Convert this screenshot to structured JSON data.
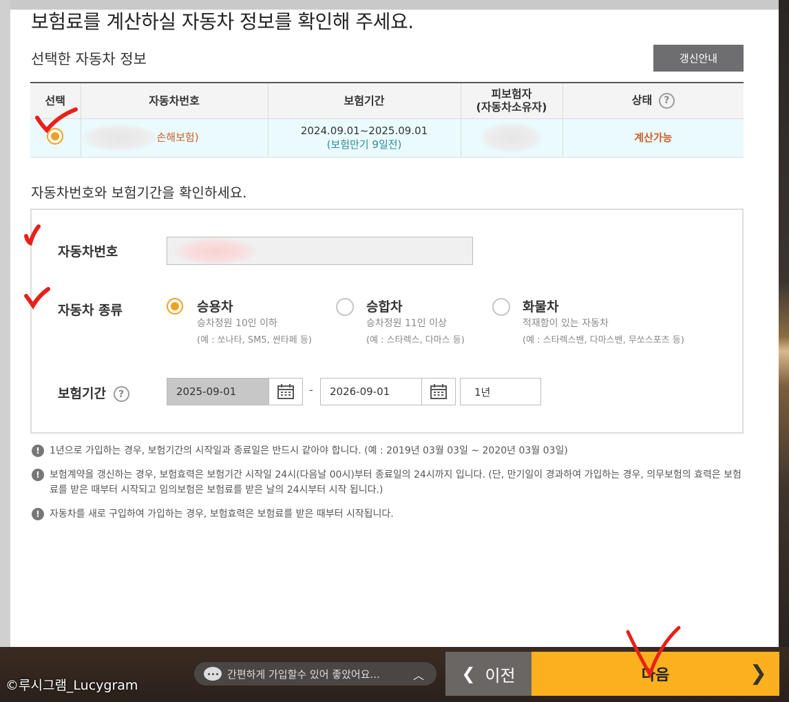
{
  "page": {
    "title": "보험료를 계산하실 자동차 정보를 확인해 주세요.",
    "selected_section_title": "선택한 자동차 정보",
    "renew_button": "갱신안내"
  },
  "table": {
    "headers": {
      "select": "선택",
      "plate": "자동차번호",
      "period": "보험기간",
      "insured_line1": "피보험자",
      "insured_line2": "(자동차소유자)",
      "status": "상태"
    },
    "row": {
      "plate_suffix": "손해보험)",
      "period": "2024.09.01~2025.09.01",
      "period_note": "(보험만기 9일전)",
      "status": "계산가능"
    }
  },
  "form": {
    "instruction": "자동차번호와 보험기간을 확인하세요.",
    "plate_label": "자동차번호",
    "type_label": "자동차 종류",
    "period_label": "보험기간",
    "options": [
      {
        "name": "승용차",
        "desc1": "승차정원 10인 이하",
        "desc2": "(예 : 쏘나타, SM5, 싼타페 등)",
        "selected": true
      },
      {
        "name": "승합차",
        "desc1": "승차정원 11인 이상",
        "desc2": "(예 : 스타렉스, 다마스 등)",
        "selected": false
      },
      {
        "name": "화물차",
        "desc1": "적재함이 있는 자동차",
        "desc2": "(예 : 스타렉스밴, 다마스밴, 무쏘스포츠 등)",
        "selected": false
      }
    ],
    "start_date": "2025-09-01",
    "end_date": "2026-09-01",
    "separator": "-",
    "duration": "1년"
  },
  "notices": [
    "1년으로 가입하는 경우, 보험기간의 시작일과 종료일은 반드시 같아야 합니다. (예 : 2019년 03월 03일 ~ 2020년 03월 03일)",
    "보험계약을 갱신하는 경우, 보험효력은 보험기간 시작일 24시(다음날 00시)부터 종료일의 24시까지 입니다. (단, 만기일이 경과하여 가입하는 경우, 의무보험의 효력은 보험료를 받은 때부터 시작되고 임의보험은 보험료를 받은 날의 24시부터 시작 됩니다.)",
    "자동차를 새로 구입하여 가입하는 경우, 보험효력은 보험료를 받은 때부터 시작됩니다."
  ],
  "footer": {
    "chat_text": "간편하게 가입할수 있어 좋았어요...",
    "prev_label": "이전",
    "next_label": "다음",
    "watermark": "©루시그램_Lucygram"
  },
  "colors": {
    "accent": "#fbb11d",
    "radio": "#f0a020",
    "status": "#c8602a",
    "annotation": "#e8201a"
  }
}
